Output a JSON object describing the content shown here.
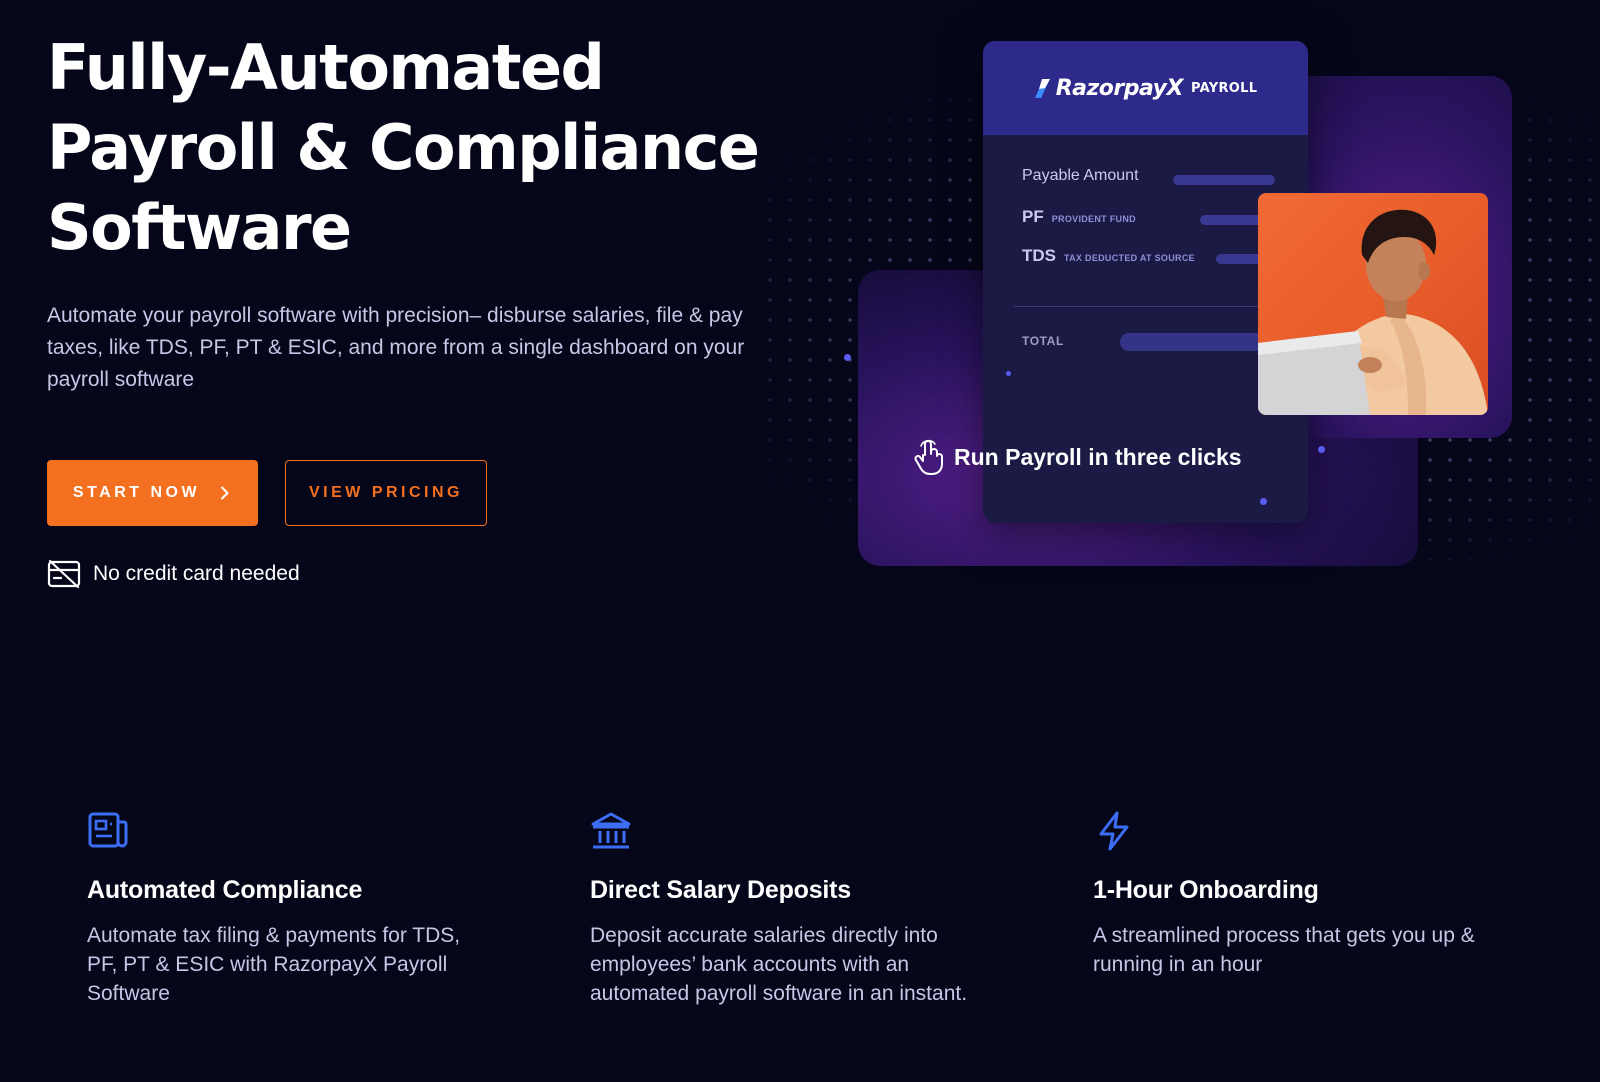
{
  "hero": {
    "title": "Fully-Automated Payroll & Compliance Software",
    "subtitle": "Automate your payroll software with precision– disburse salaries, file & pay taxes, like TDS, PF, PT & ESIC, and more from a single dashboard on your payroll software",
    "start_label": "START NOW",
    "pricing_label": "VIEW PRICING",
    "no_card_text": "No credit card needed"
  },
  "illustration": {
    "brand": "RazorpayX",
    "brand_product": "PAYROLL",
    "rows": [
      {
        "label": "Payable Amount",
        "small": ""
      },
      {
        "label": "PF",
        "small": "PROVIDENT FUND"
      },
      {
        "label": "TDS",
        "small": "TAX DEDUCTED AT SOURCE"
      }
    ],
    "total_label": "TOTAL",
    "cta": "Run Payroll in three clicks"
  },
  "features": [
    {
      "icon": "newspaper-icon",
      "title": "Automated Compliance",
      "text": "Automate tax filing & payments for TDS, PF, PT & ESIC with RazorpayX Payroll Software"
    },
    {
      "icon": "bank-icon",
      "title": "Direct Salary Deposits",
      "text": "Deposit accurate salaries directly into employees’ bank accounts with an automated payroll software in an instant."
    },
    {
      "icon": "lightning-icon",
      "title": "1-Hour Onboarding",
      "text": "A streamlined process that gets you up & running in an hour"
    }
  ],
  "colors": {
    "background": "#05061a",
    "accent_orange": "#f37021",
    "card_purple": "#2e2a8c",
    "feature_icon_blue": "#3b6df5"
  }
}
